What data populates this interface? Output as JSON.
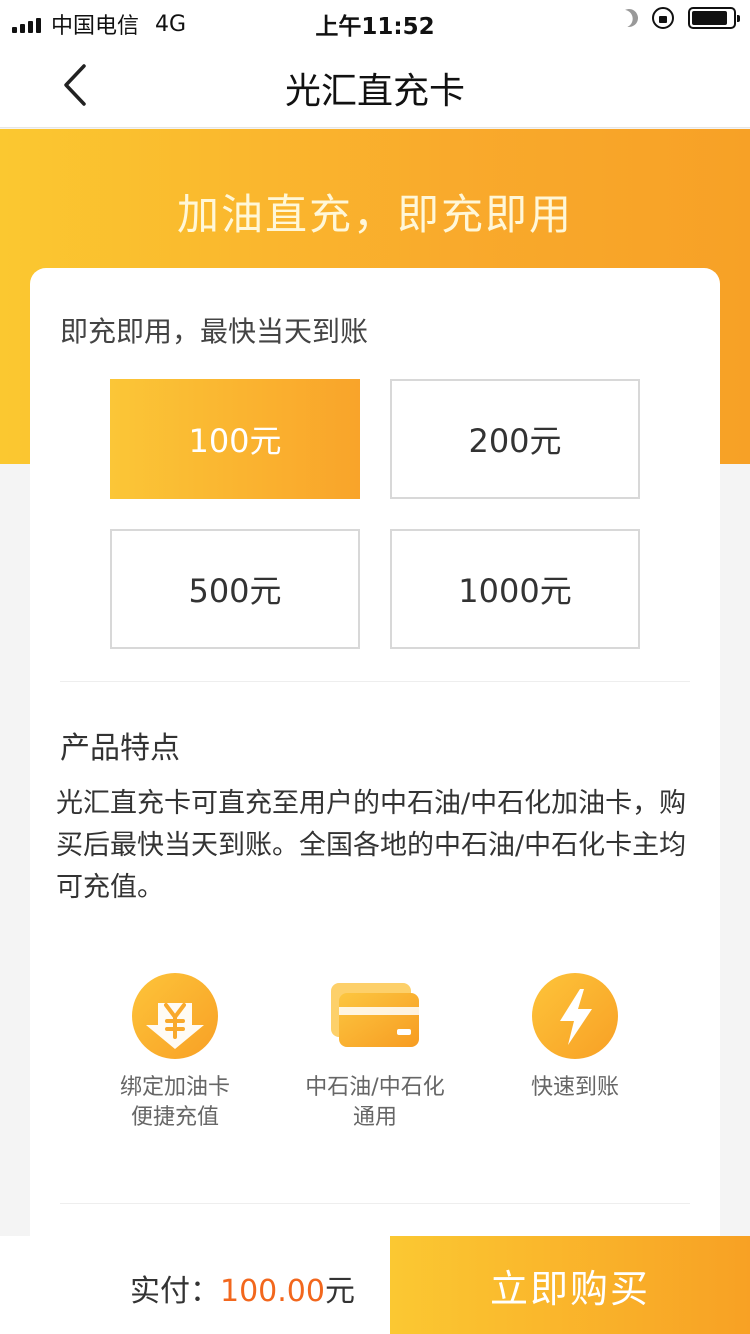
{
  "status_bar": {
    "carrier": "中国电信",
    "network": "4G",
    "time": "上午11:52"
  },
  "nav": {
    "title": "光汇直充卡",
    "back_icon": "chevron-left-icon"
  },
  "banner": {
    "title": "加油直充，即充即用"
  },
  "card": {
    "subtitle": "即充即用，最快当天到账",
    "amount_options": [
      {
        "label": "100元",
        "selected": true
      },
      {
        "label": "200元",
        "selected": false
      },
      {
        "label": "500元",
        "selected": false
      },
      {
        "label": "1000元",
        "selected": false
      }
    ],
    "features_heading": "产品特点",
    "features_desc": "光汇直充卡可直充至用户的中石油/中石化加油卡，购买后最快当天到账。全国各地的中石油/中石化卡主均可充值。",
    "features": [
      {
        "icon": "yen-download-icon",
        "line1": "绑定加油卡",
        "line2": "便捷充值"
      },
      {
        "icon": "card-icon",
        "line1": "中石油/中石化",
        "line2": "通用"
      },
      {
        "icon": "lightning-icon",
        "line1": "快速到账",
        "line2": ""
      }
    ]
  },
  "bottom": {
    "pay_label": "实付：",
    "pay_amount": "100.00",
    "pay_unit": "元",
    "buy_label": "立即购买"
  },
  "colors": {
    "accent": "#f9a92b",
    "price": "#f2671d"
  }
}
